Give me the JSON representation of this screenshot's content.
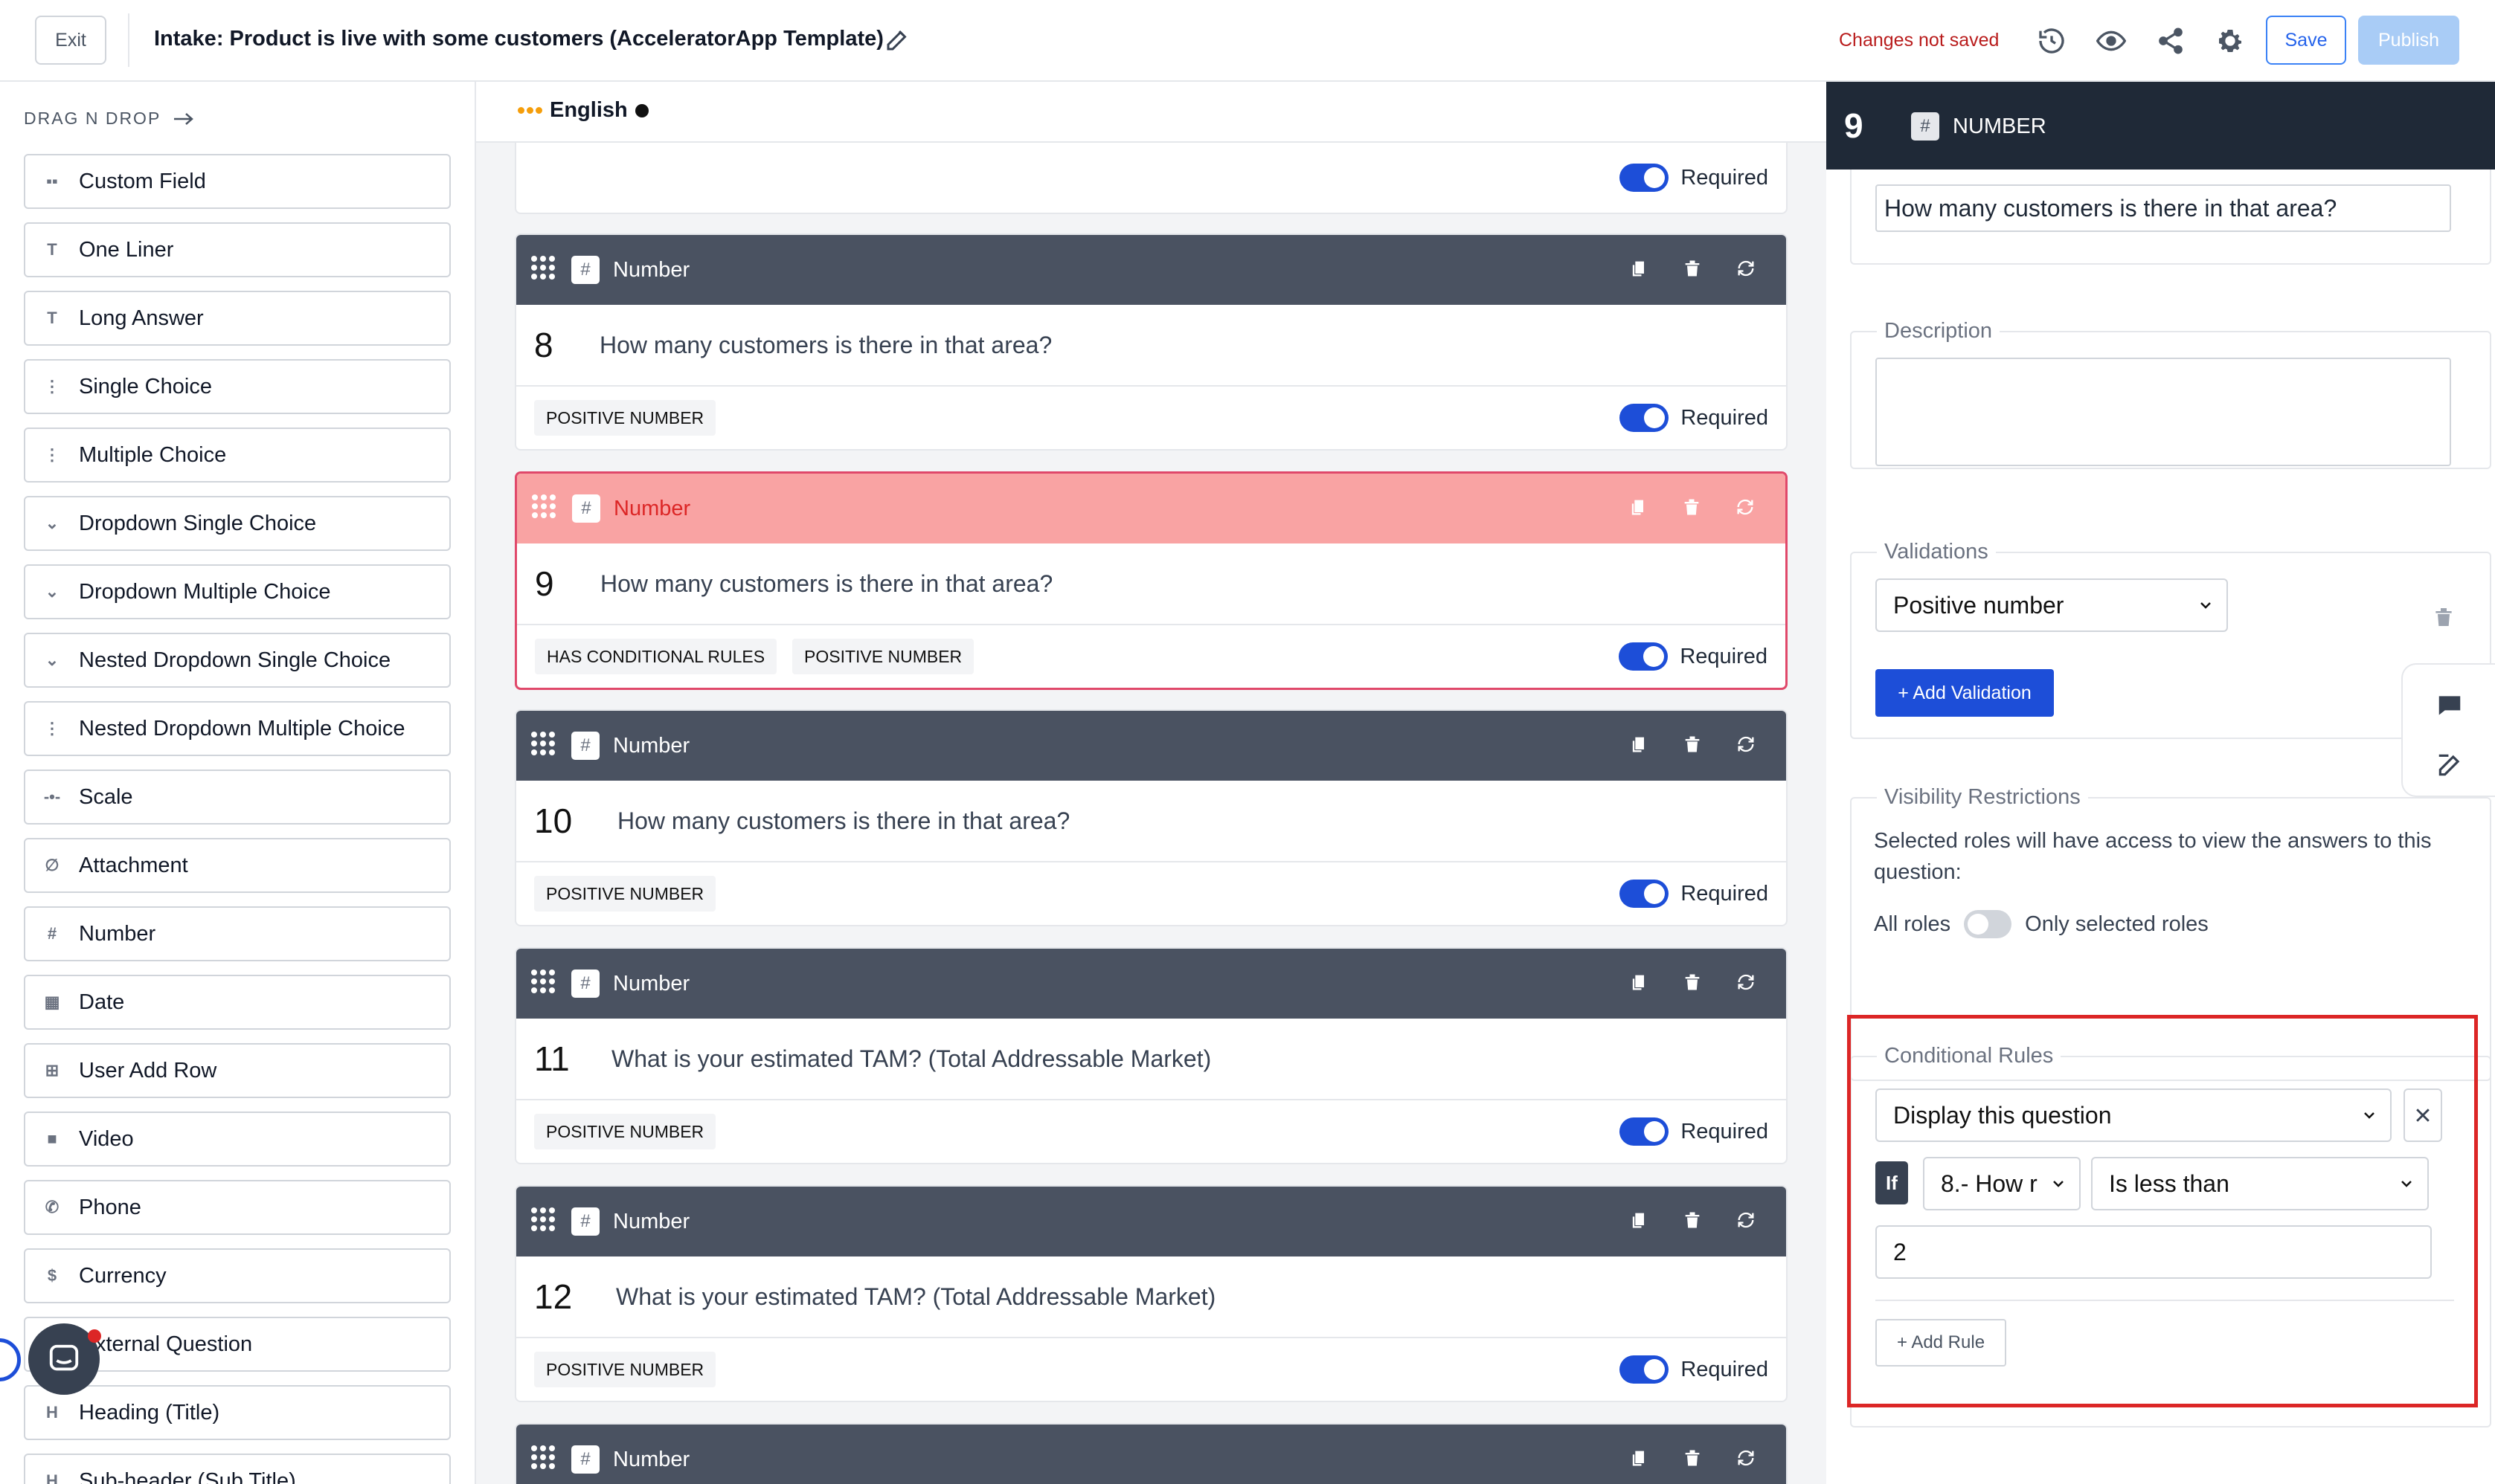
{
  "topbar": {
    "exit_label": "Exit",
    "title": "Intake: Product is live with some customers (AcceleratorApp Template)",
    "status": "Changes not saved",
    "save_label": "Save",
    "publish_label": "Publish"
  },
  "sidebar": {
    "header": "DRAG N DROP",
    "items": [
      {
        "label": "Custom Field",
        "icon": "grid-icon"
      },
      {
        "label": "One Liner",
        "icon": "text-icon"
      },
      {
        "label": "Long Answer",
        "icon": "text-icon"
      },
      {
        "label": "Single Choice",
        "icon": "list-icon"
      },
      {
        "label": "Multiple Choice",
        "icon": "list-icon"
      },
      {
        "label": "Dropdown Single Choice",
        "icon": "chevron-down-icon"
      },
      {
        "label": "Dropdown Multiple Choice",
        "icon": "chevron-down-icon"
      },
      {
        "label": "Nested Dropdown Single Choice",
        "icon": "chevron-down-icon"
      },
      {
        "label": "Nested Dropdown Multiple Choice",
        "icon": "list-icon"
      },
      {
        "label": "Scale",
        "icon": "scale-icon"
      },
      {
        "label": "Attachment",
        "icon": "paperclip-icon"
      },
      {
        "label": "Number",
        "icon": "hash-icon"
      },
      {
        "label": "Date",
        "icon": "calendar-icon"
      },
      {
        "label": "User Add Row",
        "icon": "add-row-icon"
      },
      {
        "label": "Video",
        "icon": "video-icon"
      },
      {
        "label": "Phone",
        "icon": "phone-icon"
      },
      {
        "label": "Currency",
        "icon": "currency-icon"
      },
      {
        "label": "xternal Question",
        "icon": "external-icon"
      },
      {
        "label": "Heading (Title)",
        "icon": "heading-icon"
      },
      {
        "label": "Sub-header (Sub Title)",
        "icon": "subheading-icon"
      }
    ]
  },
  "main": {
    "language": "English",
    "partial_required": "Required",
    "cards": [
      {
        "type": "Number",
        "num": "8",
        "question": "How many customers is there in that area?",
        "tags": [
          "POSITIVE NUMBER"
        ],
        "required": "Required"
      },
      {
        "type": "Number",
        "num": "9",
        "question": "How many customers is there in that area?",
        "tags": [
          "HAS CONDITIONAL RULES",
          "POSITIVE NUMBER"
        ],
        "required": "Required"
      },
      {
        "type": "Number",
        "num": "10",
        "question": "How many customers is there in that area?",
        "tags": [
          "POSITIVE NUMBER"
        ],
        "required": "Required"
      },
      {
        "type": "Number",
        "num": "11",
        "question": "What is your estimated TAM? (Total Addressable Market)",
        "tags": [
          "POSITIVE NUMBER"
        ],
        "required": "Required"
      },
      {
        "type": "Number",
        "num": "12",
        "question": "What is your estimated TAM? (Total Addressable Market)",
        "tags": [
          "POSITIVE NUMBER"
        ],
        "required": "Required"
      },
      {
        "type": "Number"
      }
    ]
  },
  "panel": {
    "num": "9",
    "type": "NUMBER",
    "question_value": "How many customers is there in that area?",
    "description_label": "Description",
    "description_value": "",
    "validations_label": "Validations",
    "validation_value": "Positive number",
    "add_validation_label": "+ Add Validation",
    "visibility_label": "Visibility Restrictions",
    "visibility_text": "Selected roles will have access to view the answers to this question:",
    "all_roles": "All roles",
    "only_selected": "Only selected roles",
    "conditional_label": "Conditional Rules",
    "action_value": "Display this question",
    "if_label": "If",
    "field_value": "8.- How r",
    "operator_value": "Is less than",
    "rule_value": "2",
    "add_rule_label": "+ Add Rule"
  },
  "colors": {
    "accent": "#1d4ed8",
    "header_dark": "#4a5261",
    "selected_header": "#f9a3a3",
    "highlight": "#dc2626"
  }
}
